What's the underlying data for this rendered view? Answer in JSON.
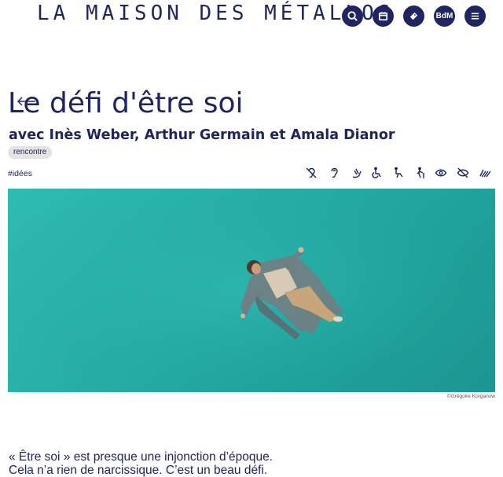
{
  "header": {
    "brand": "LA MAISON DES MÉTALLOS",
    "buttons": [
      {
        "name": "search-icon"
      },
      {
        "name": "calendar-icon"
      },
      {
        "name": "ticket-icon"
      },
      {
        "name": "bdm-button",
        "label": "BdM"
      },
      {
        "name": "menu-icon"
      }
    ]
  },
  "event": {
    "title": "Le défi d'être soi",
    "subtitle": "avec Inès Weber, Arthur Germain et Amala Dianor",
    "tag": "rencontre",
    "hashtag": "#idées",
    "accessibility_icons": [
      "deaf-icon",
      "hearing-loop-icon",
      "sign-language-icon",
      "wheelchair-icon",
      "reduced-mobility-icon",
      "walking-cane-icon",
      "visible-eye-icon",
      "visually-impaired-icon",
      "sign-hands-icon"
    ]
  },
  "hero": {
    "credit": "©Grégoire Korganow",
    "colors": {
      "water": "#26aea6",
      "coat": "#6f7f84"
    }
  },
  "intro": {
    "line1": "« Être soi » est presque une injonction d’époque.",
    "line2": "Cela n’a rien de narcissique. C’est un beau défi."
  },
  "colors": {
    "primary": "#1f2561",
    "tag_bg": "#e3e3e3"
  }
}
